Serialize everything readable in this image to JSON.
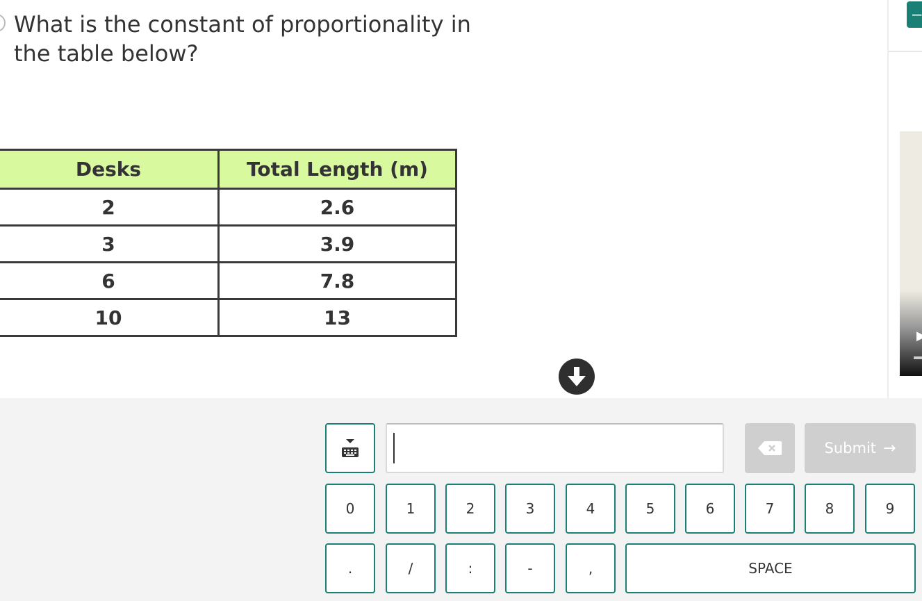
{
  "question": {
    "line1": "What is the constant of proportionality in",
    "line2": "the table below?"
  },
  "table": {
    "headers": [
      "Desks",
      "Total Length (m)"
    ],
    "rows": [
      [
        "2",
        "2.6"
      ],
      [
        "3",
        "3.9"
      ],
      [
        "6",
        "7.8"
      ],
      [
        "10",
        "13"
      ]
    ],
    "header_color": "#d9f99f"
  },
  "colors": {
    "accent": "#1a7f74",
    "keypad_bg": "#f3f3f3",
    "disabled": "#cfcfcf"
  },
  "answer": {
    "value": ""
  },
  "keypad": {
    "digits": [
      "0",
      "1",
      "2",
      "3",
      "4",
      "5",
      "6",
      "7",
      "8",
      "9"
    ],
    "symbols": [
      ".",
      "/",
      ":",
      "-",
      ","
    ],
    "space_label": "SPACE",
    "submit_label": "Submit",
    "submit_arrow": "→"
  },
  "icons": {
    "scroll": "arrow-down-circle-icon",
    "keyboard": "keyboard-toggle-icon",
    "backspace": "backspace-icon"
  }
}
